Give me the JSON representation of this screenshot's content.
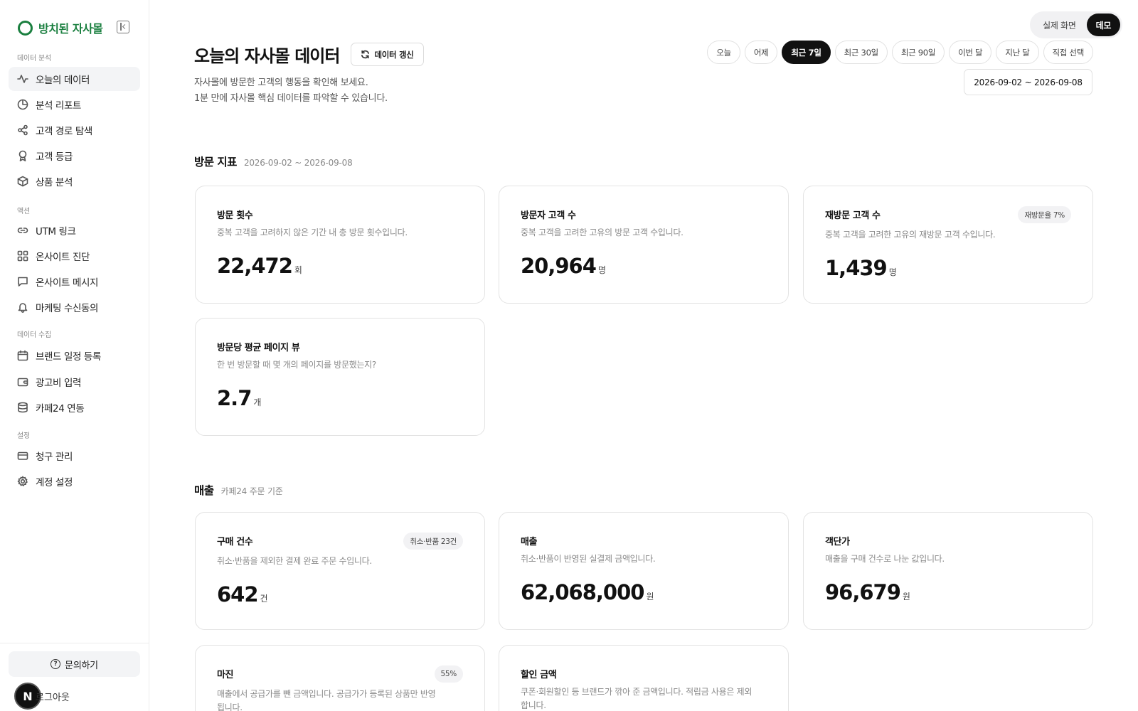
{
  "brand": {
    "name": "방치된 자사몰"
  },
  "sidebar": {
    "groups": [
      {
        "label": "데이터 분석",
        "items": [
          {
            "label": "오늘의 데이터",
            "icon": "activity-icon"
          },
          {
            "label": "분석 리포트",
            "icon": "pie-chart-icon"
          },
          {
            "label": "고객 경로 탐색",
            "icon": "share-nodes-icon"
          },
          {
            "label": "고객 등급",
            "icon": "award-icon"
          },
          {
            "label": "상품 분석",
            "icon": "package-icon"
          }
        ]
      },
      {
        "label": "액션",
        "items": [
          {
            "label": "UTM 링크",
            "icon": "link-icon"
          },
          {
            "label": "온사이트 진단",
            "icon": "grid-icon"
          },
          {
            "label": "온사이트 메시지",
            "icon": "message-icon"
          },
          {
            "label": "마케팅 수신동의",
            "icon": "bell-icon"
          }
        ]
      },
      {
        "label": "데이터 수집",
        "items": [
          {
            "label": "브랜드 일정 등록",
            "icon": "calendar-icon"
          },
          {
            "label": "광고비 입력",
            "icon": "wallet-icon"
          },
          {
            "label": "카페24 연동",
            "icon": "database-icon"
          }
        ]
      },
      {
        "label": "설정",
        "items": [
          {
            "label": "청구 관리",
            "icon": "credit-card-icon"
          },
          {
            "label": "계정 설정",
            "icon": "gear-icon"
          }
        ]
      }
    ],
    "help_label": "문의하기",
    "logout_label": "로그아웃",
    "avatar_initial": "N"
  },
  "view_toggle": {
    "real": "실제 화면",
    "demo": "데모"
  },
  "header": {
    "title": "오늘의 자사몰 데이터",
    "refresh_label": "데이터 갱신",
    "subtitle_line1": "자사몰에 방문한 고객의 행동을 확인해 보세요.",
    "subtitle_line2": "1분 만에 자사몰 핵심 데이터를 파악할 수 있습니다.",
    "range_tabs": [
      "오늘",
      "어제",
      "최근 7일",
      "최근 30일",
      "최근 90일",
      "이번 달",
      "지난 달",
      "직접 선택"
    ],
    "active_range": "최근 7일",
    "date_range": "2026-09-02 ~ 2026-09-08"
  },
  "visits": {
    "title": "방문 지표",
    "subtitle": "2026-09-02 ~ 2026-09-08",
    "cards": [
      {
        "title": "방문 횟수",
        "desc": "중복 고객을 고려하지 않은 기간 내 총 방문 횟수입니다.",
        "value": "22,472",
        "unit": "회"
      },
      {
        "title": "방문자 고객 수",
        "desc": "중복 고객을 고려한 고유의 방문 고객 수입니다.",
        "value": "20,964",
        "unit": "명"
      },
      {
        "title": "재방문 고객 수",
        "desc": "중복 고객을 고려한 고유의 재방문 고객 수입니다.",
        "value": "1,439",
        "unit": "명",
        "badge": "재방문율 7%"
      },
      {
        "title": "방문당 평균 페이지 뷰",
        "desc": "한 번 방문할 때 몇 개의 페이지를 방문했는지?",
        "value": "2.7",
        "unit": "개"
      }
    ]
  },
  "sales": {
    "title": "매출",
    "subtitle": "카페24 주문 기준",
    "cards": [
      {
        "title": "구매 건수",
        "desc": "취소·반품을 제외한 결제 완료 주문 수입니다.",
        "value": "642",
        "unit": "건",
        "badge": "취소·반품 23건"
      },
      {
        "title": "매출",
        "desc": "취소·반품이 반영된 실결제 금액입니다.",
        "value": "62,068,000",
        "unit": "원"
      },
      {
        "title": "객단가",
        "desc": "매출을 구매 건수로 나눈 값입니다.",
        "value": "96,679",
        "unit": "원"
      },
      {
        "title": "마진",
        "desc": "매출에서 공급가를 뺀 금액입니다. 공급가가 등록된 상품만 반영됩니다.",
        "badge": "55%"
      },
      {
        "title": "할인 금액",
        "desc": "쿠폰·회원할인 등 브랜드가 깎아 준 금액입니다. 적립금 사용은 제외합니다."
      }
    ]
  }
}
